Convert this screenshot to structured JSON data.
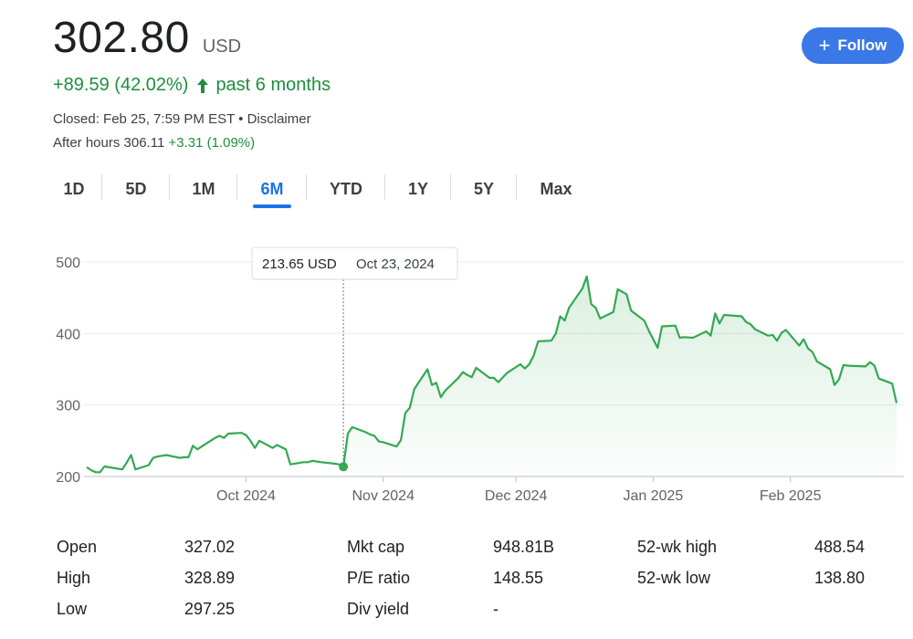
{
  "header": {
    "price": "302.80",
    "currency": "USD",
    "change": "+89.59 (42.02%)",
    "period": "past 6 months",
    "closed": "Closed: Feb 25, 7:59 PM EST • Disclaimer",
    "after_hours_label": "After hours 306.11",
    "after_hours_change": "+3.31 (1.09%)"
  },
  "follow_button": {
    "label": "Follow",
    "icon": "plus-icon",
    "color": "#3b78e7"
  },
  "tabs": [
    {
      "label": "1D",
      "active": false
    },
    {
      "label": "5D",
      "active": false
    },
    {
      "label": "1M",
      "active": false
    },
    {
      "label": "6M",
      "active": true
    },
    {
      "label": "YTD",
      "active": false
    },
    {
      "label": "1Y",
      "active": false
    },
    {
      "label": "5Y",
      "active": false
    },
    {
      "label": "Max",
      "active": false
    }
  ],
  "tooltip": {
    "value": "213.65 USD",
    "date": "Oct 23, 2024"
  },
  "chart_data": {
    "type": "area",
    "line_color": "#34a853",
    "y_ticks": [
      200,
      300,
      400,
      500
    ],
    "ylim": [
      200,
      500
    ],
    "x_labels": [
      "Oct 2024",
      "Nov 2024",
      "Dec 2024",
      "Jan 2025",
      "Feb 2025"
    ],
    "x_label_dates": [
      "2024-10-01",
      "2024-11-01",
      "2024-12-01",
      "2025-01-01",
      "2025-02-01"
    ],
    "grid": true,
    "series": [
      {
        "points": [
          [
            "2024-08-26",
            213
          ],
          [
            "2024-08-27",
            209
          ],
          [
            "2024-08-28",
            206
          ],
          [
            "2024-08-29",
            206
          ],
          [
            "2024-08-30",
            214
          ],
          [
            "2024-09-03",
            210
          ],
          [
            "2024-09-04",
            219
          ],
          [
            "2024-09-05",
            230
          ],
          [
            "2024-09-06",
            210
          ],
          [
            "2024-09-09",
            216
          ],
          [
            "2024-09-10",
            226
          ],
          [
            "2024-09-11",
            228
          ],
          [
            "2024-09-12",
            229
          ],
          [
            "2024-09-13",
            230
          ],
          [
            "2024-09-16",
            226
          ],
          [
            "2024-09-17",
            227
          ],
          [
            "2024-09-18",
            227
          ],
          [
            "2024-09-19",
            243
          ],
          [
            "2024-09-20",
            238
          ],
          [
            "2024-09-23",
            250
          ],
          [
            "2024-09-24",
            254
          ],
          [
            "2024-09-25",
            257
          ],
          [
            "2024-09-26",
            254
          ],
          [
            "2024-09-27",
            260
          ],
          [
            "2024-09-30",
            261
          ],
          [
            "2024-10-01",
            258
          ],
          [
            "2024-10-02",
            250
          ],
          [
            "2024-10-03",
            240
          ],
          [
            "2024-10-04",
            250
          ],
          [
            "2024-10-07",
            240
          ],
          [
            "2024-10-08",
            244
          ],
          [
            "2024-10-09",
            241
          ],
          [
            "2024-10-10",
            238
          ],
          [
            "2024-10-11",
            217
          ],
          [
            "2024-10-14",
            220
          ],
          [
            "2024-10-15",
            220
          ],
          [
            "2024-10-16",
            222
          ],
          [
            "2024-10-17",
            221
          ],
          [
            "2024-10-18",
            220
          ],
          [
            "2024-10-21",
            218
          ],
          [
            "2024-10-22",
            217
          ],
          [
            "2024-10-23",
            213.65
          ],
          [
            "2024-10-24",
            260
          ],
          [
            "2024-10-25",
            269
          ],
          [
            "2024-10-28",
            262
          ],
          [
            "2024-10-29",
            259
          ],
          [
            "2024-10-30",
            257
          ],
          [
            "2024-10-31",
            249
          ],
          [
            "2024-11-01",
            248
          ],
          [
            "2024-11-04",
            242
          ],
          [
            "2024-11-05",
            251
          ],
          [
            "2024-11-06",
            289
          ],
          [
            "2024-11-07",
            296
          ],
          [
            "2024-11-08",
            322
          ],
          [
            "2024-11-11",
            350
          ],
          [
            "2024-11-12",
            328
          ],
          [
            "2024-11-13",
            331
          ],
          [
            "2024-11-14",
            311
          ],
          [
            "2024-11-15",
            320
          ],
          [
            "2024-11-18",
            338
          ],
          [
            "2024-11-19",
            346
          ],
          [
            "2024-11-20",
            342
          ],
          [
            "2024-11-21",
            339
          ],
          [
            "2024-11-22",
            352
          ],
          [
            "2024-11-25",
            338
          ],
          [
            "2024-11-26",
            338
          ],
          [
            "2024-11-27",
            332
          ],
          [
            "2024-11-29",
            345
          ],
          [
            "2024-12-02",
            357
          ],
          [
            "2024-12-03",
            351
          ],
          [
            "2024-12-04",
            357
          ],
          [
            "2024-12-05",
            369
          ],
          [
            "2024-12-06",
            389
          ],
          [
            "2024-12-09",
            390
          ],
          [
            "2024-12-10",
            400
          ],
          [
            "2024-12-11",
            424
          ],
          [
            "2024-12-12",
            418
          ],
          [
            "2024-12-13",
            436
          ],
          [
            "2024-12-16",
            463
          ],
          [
            "2024-12-17",
            480
          ],
          [
            "2024-12-18",
            441
          ],
          [
            "2024-12-19",
            436
          ],
          [
            "2024-12-20",
            421
          ],
          [
            "2024-12-23",
            430
          ],
          [
            "2024-12-24",
            462
          ],
          [
            "2024-12-26",
            455
          ],
          [
            "2024-12-27",
            432
          ],
          [
            "2024-12-30",
            418
          ],
          [
            "2024-12-31",
            404
          ],
          [
            "2025-01-02",
            380
          ],
          [
            "2025-01-03",
            410
          ],
          [
            "2025-01-06",
            411
          ],
          [
            "2025-01-07",
            394
          ],
          [
            "2025-01-08",
            395
          ],
          [
            "2025-01-10",
            394
          ],
          [
            "2025-01-13",
            403
          ],
          [
            "2025-01-14",
            397
          ],
          [
            "2025-01-15",
            428
          ],
          [
            "2025-01-16",
            414
          ],
          [
            "2025-01-17",
            426
          ],
          [
            "2025-01-21",
            424
          ],
          [
            "2025-01-22",
            416
          ],
          [
            "2025-01-23",
            413
          ],
          [
            "2025-01-24",
            406
          ],
          [
            "2025-01-27",
            397
          ],
          [
            "2025-01-28",
            398
          ],
          [
            "2025-01-29",
            390
          ],
          [
            "2025-01-30",
            401
          ],
          [
            "2025-01-31",
            405
          ],
          [
            "2025-02-03",
            383
          ],
          [
            "2025-02-04",
            392
          ],
          [
            "2025-02-05",
            379
          ],
          [
            "2025-02-06",
            374
          ],
          [
            "2025-02-07",
            361
          ],
          [
            "2025-02-10",
            350
          ],
          [
            "2025-02-11",
            328
          ],
          [
            "2025-02-12",
            336
          ],
          [
            "2025-02-13",
            356
          ],
          [
            "2025-02-14",
            355
          ],
          [
            "2025-02-18",
            354
          ],
          [
            "2025-02-19",
            360
          ],
          [
            "2025-02-20",
            355
          ],
          [
            "2025-02-21",
            337
          ],
          [
            "2025-02-24",
            330
          ],
          [
            "2025-02-25",
            302.8
          ]
        ]
      }
    ],
    "marker": {
      "date": "2024-10-23",
      "value": 213.65
    }
  },
  "stats": [
    {
      "label": "Open",
      "value": "327.02"
    },
    {
      "label": "High",
      "value": "328.89"
    },
    {
      "label": "Low",
      "value": "297.25"
    },
    {
      "label": "Mkt cap",
      "value": "948.81B"
    },
    {
      "label": "P/E ratio",
      "value": "148.55"
    },
    {
      "label": "Div yield",
      "value": "-"
    },
    {
      "label": "52-wk high",
      "value": "488.54"
    },
    {
      "label": "52-wk low",
      "value": "138.80"
    }
  ]
}
